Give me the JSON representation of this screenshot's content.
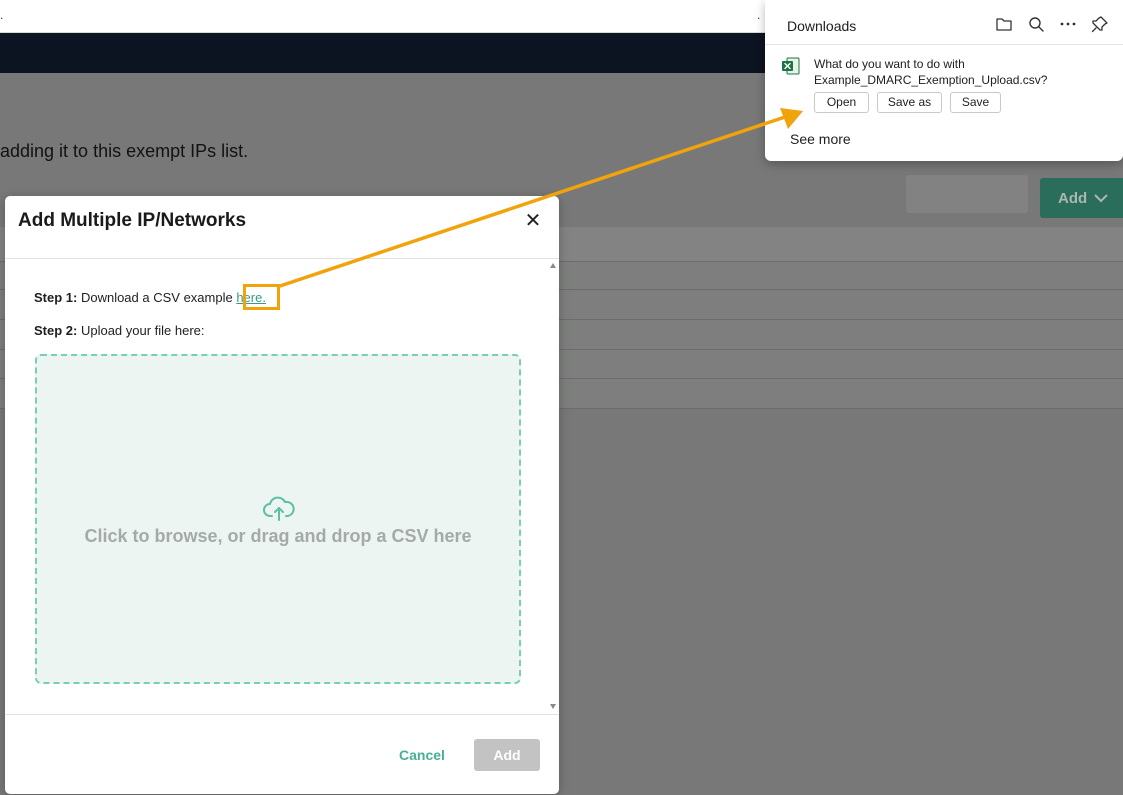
{
  "browser": {
    "left_fragment": ".",
    "right_fragment": "."
  },
  "page": {
    "description_fragment": "adding it to this exempt IPs list.",
    "add_button_label": "Add"
  },
  "modal": {
    "title": "Add Multiple IP/Networks",
    "close_symbol": "✕",
    "step1_label": "Step 1:",
    "step1_text": " Download a CSV example ",
    "step1_link": "here.",
    "step2_label": "Step 2:",
    "step2_text": " Upload your file here:",
    "dropzone_text": "Click to browse, or drag and drop a CSV here",
    "cancel_label": "Cancel",
    "add_label": "Add"
  },
  "downloads": {
    "title": "Downloads",
    "question_line1": "What do you want to do with",
    "question_line2": "Example_DMARC_Exemption_Upload.csv?",
    "open_label": "Open",
    "save_as_label": "Save as",
    "save_label": "Save",
    "see_more_label": "See more",
    "tools": [
      "folder-icon",
      "search-icon",
      "more-icon",
      "pin-icon"
    ]
  },
  "colors": {
    "accent": "#44b197",
    "highlight": "#f0a30a",
    "nav": "#0d1421",
    "add_button": "#2a6d5b",
    "excel_green": "#1f7244"
  }
}
